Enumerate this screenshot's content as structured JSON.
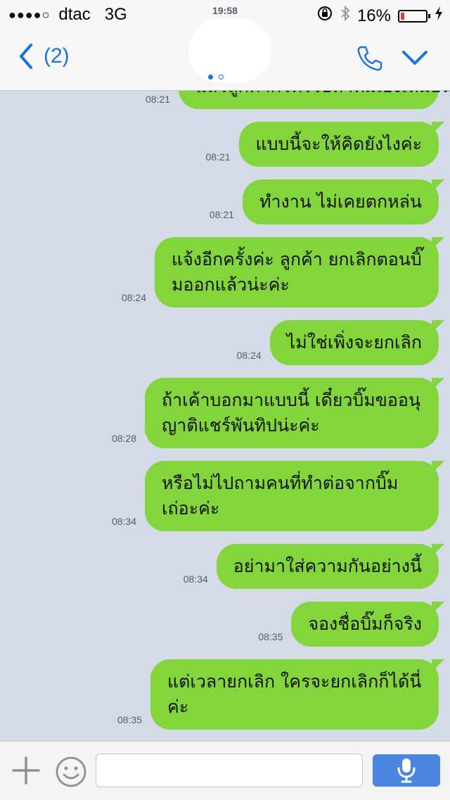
{
  "status_bar": {
    "signal_dots": "●●●●○",
    "carrier": "dtac",
    "network": "3G",
    "time": "19:58",
    "battery_text": "16%",
    "battery_level": 0.16
  },
  "nav": {
    "back_count": "(2)",
    "page_count": 2,
    "current_page": 1,
    "accent_color": "#1c74d9"
  },
  "messages": [
    {
      "time": "08:21",
      "text": "แล้วลูกค้าก็โทรไปหาทีมเองเหมือนเดิม"
    },
    {
      "time": "08:21",
      "text": "แบบนี้จะให้คิดยังไงค่ะ"
    },
    {
      "time": "08:21",
      "text": "ทำงาน ไม่เคยตกหล่น"
    },
    {
      "time": "08:24",
      "text": "แจ้งอีกครั้งค่ะ ลูกค้า ยกเลิกตอนบิ๊มออกแล้วน่ะค่ะ"
    },
    {
      "time": "08:24",
      "text": "ไม่ใช่เพิ่งจะยกเลิก"
    },
    {
      "time": "08:28",
      "text": "ถ้าเค้าบอกมาแบบนี้ เดี๋ยวบิ๊มขออนุญาติแชร์พันทิปน่ะค่ะ"
    },
    {
      "time": "08:34",
      "text": "หรือไม่ไปถามคนที่ทำต่อจากบิ๊มเถ่อะค่ะ"
    },
    {
      "time": "08:34",
      "text": "อย่ามาใส่ความกันอย่างนี้"
    },
    {
      "time": "08:35",
      "text": "จองชื่อบิ๊มก็จริง"
    },
    {
      "time": "08:35",
      "text": "แต่เวลายกเลิก ใครจะยกเลิกก็ได้นี่ค่ะ"
    }
  ],
  "input": {
    "value": "",
    "placeholder": ""
  },
  "colors": {
    "bubble": "#82d53a",
    "background": "#d4dae6",
    "mic_button": "#4a86e0"
  }
}
